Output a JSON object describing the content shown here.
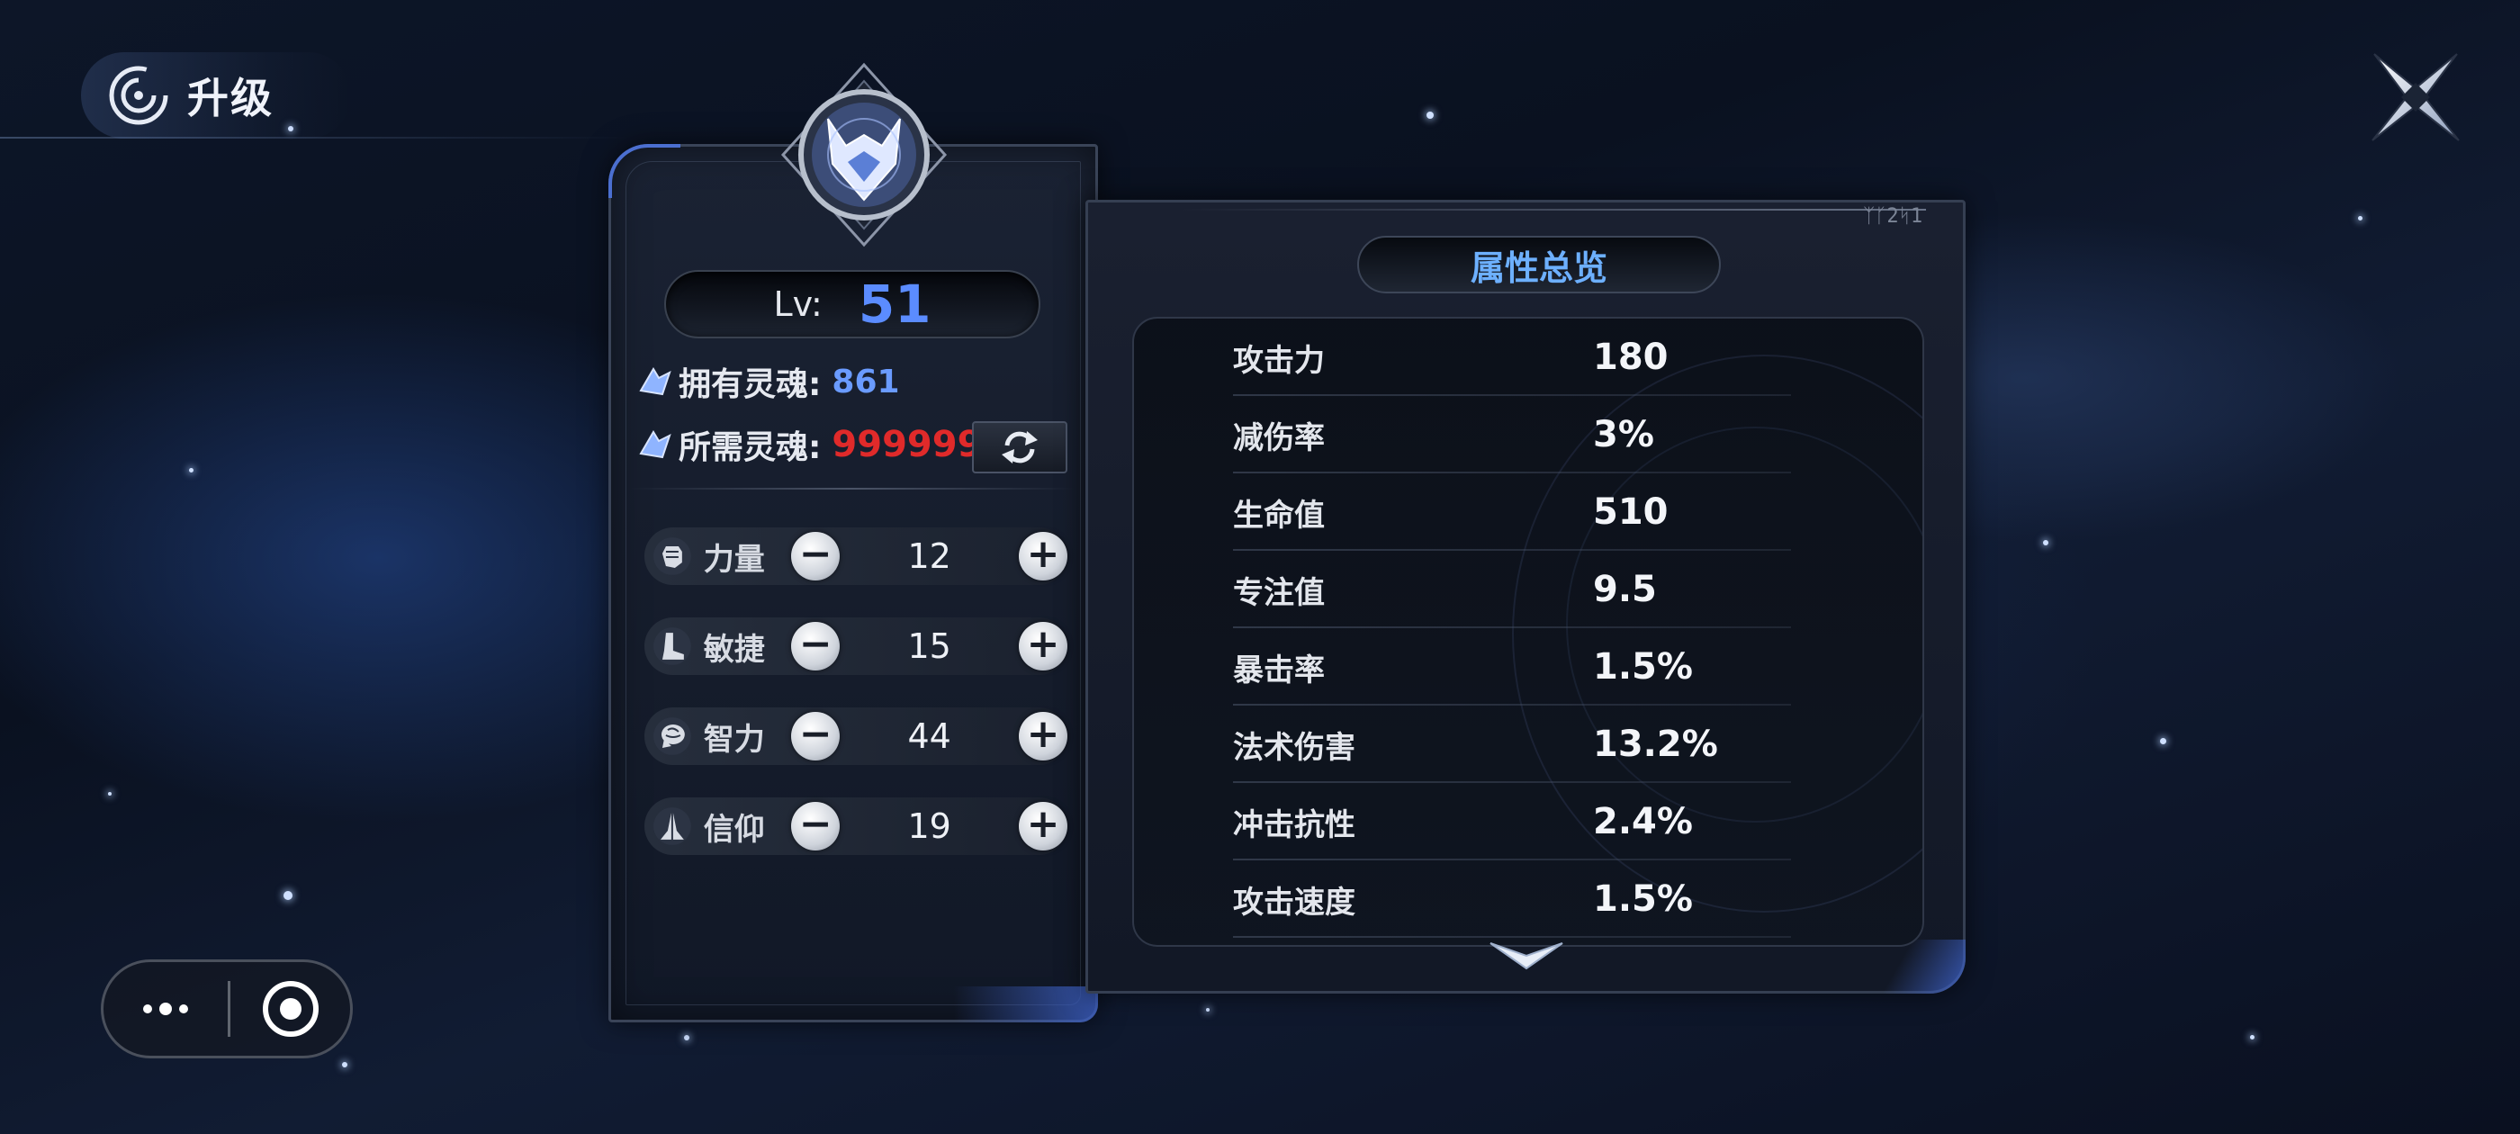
{
  "header": {
    "title": "升级"
  },
  "level": {
    "label": "Lv:",
    "value": "51"
  },
  "souls": {
    "owned_label": "拥有灵魂:",
    "owned_value": "861",
    "needed_label": "所需灵魂:",
    "needed_value": "999999"
  },
  "stats": [
    {
      "label": "力量",
      "value": "12",
      "icon": "fist-icon"
    },
    {
      "label": "敏捷",
      "value": "15",
      "icon": "boot-icon"
    },
    {
      "label": "智力",
      "value": "44",
      "icon": "brain-icon"
    },
    {
      "label": "信仰",
      "value": "19",
      "icon": "praying-hands-icon"
    }
  ],
  "attributes": {
    "title": "属性总览",
    "corner_text": "ᛉᚴ2ᛋ1",
    "rows": [
      {
        "name": "攻击力",
        "value": "180"
      },
      {
        "name": "减伤率",
        "value": "3%"
      },
      {
        "name": "生命值",
        "value": "510"
      },
      {
        "name": "专注值",
        "value": "9.5"
      },
      {
        "name": "暴击率",
        "value": "1.5%"
      },
      {
        "name": "法术伤害",
        "value": "13.2%"
      },
      {
        "name": "冲击抗性",
        "value": "2.4%"
      },
      {
        "name": "攻击速度",
        "value": "1.5%"
      }
    ]
  },
  "colors": {
    "level_value": "#5b8cff",
    "soul_owned": "#6a9bff",
    "soul_needed": "#e02a2a",
    "attr_title": "#6db0ff"
  }
}
